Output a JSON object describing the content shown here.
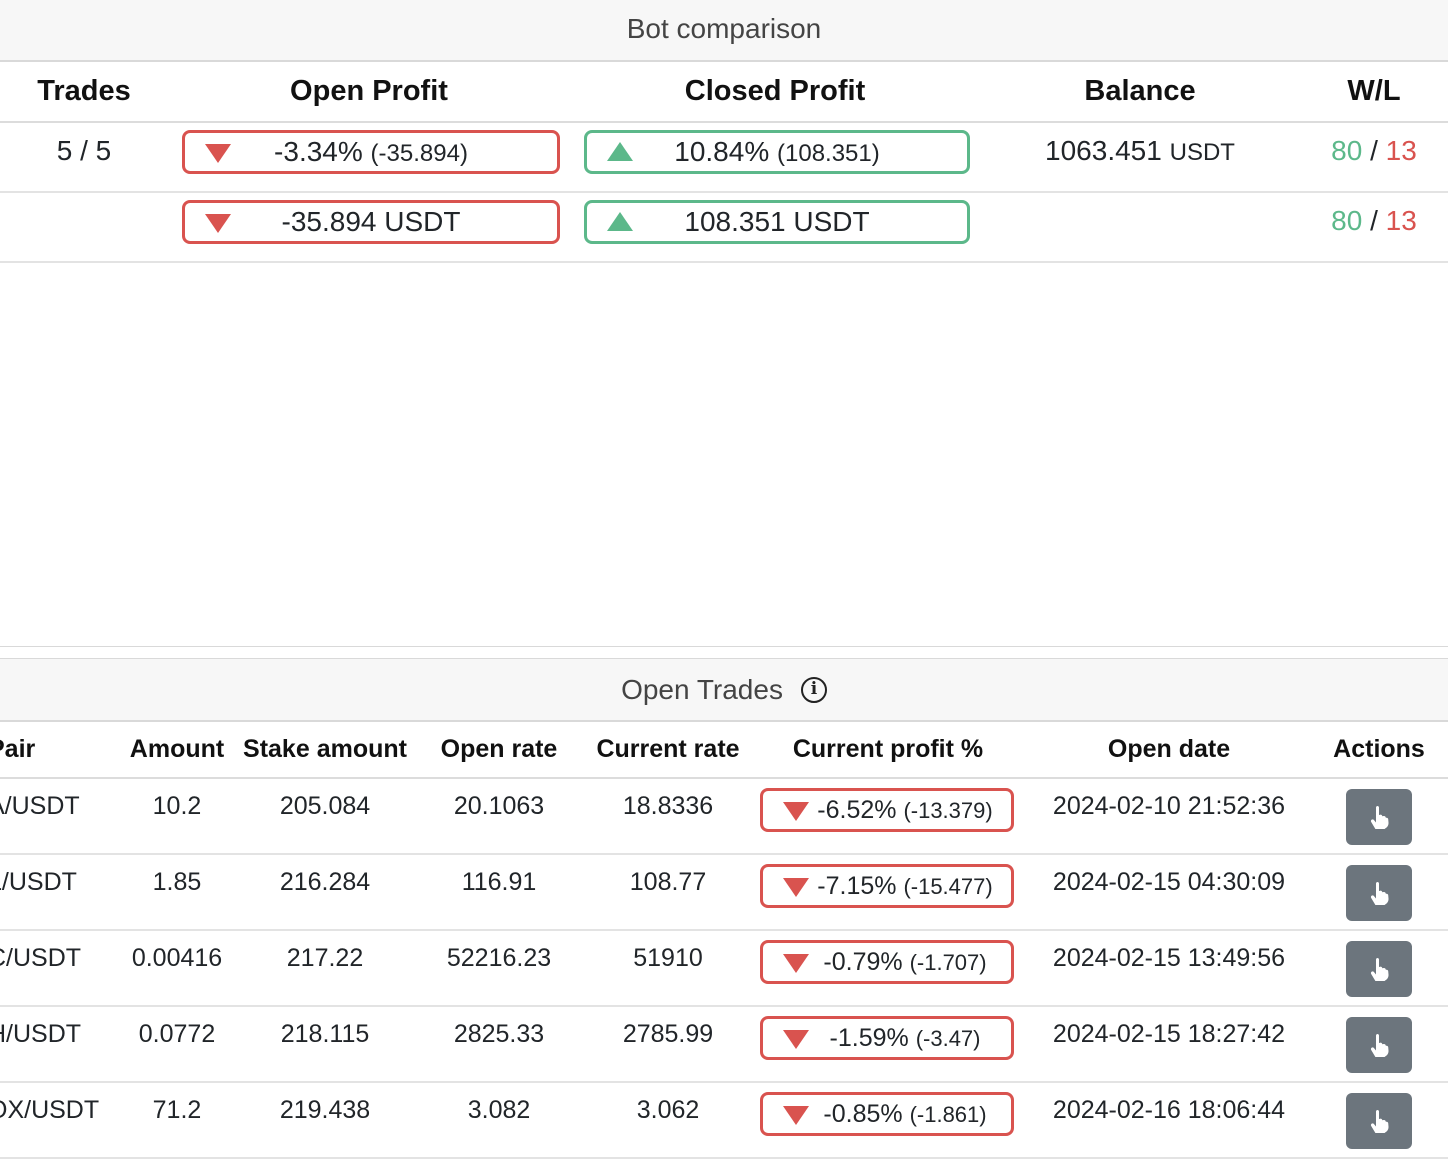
{
  "bot_comparison": {
    "title": "Bot comparison",
    "columns": {
      "trades": "Trades",
      "open_profit": "Open Profit",
      "closed_profit": "Closed Profit",
      "balance": "Balance",
      "wl": "W/L"
    },
    "rows": [
      {
        "trades": "5 / 5",
        "open_profit_main": "-3.34%",
        "open_profit_sub": "(-35.894)",
        "closed_profit_main": "10.84%",
        "closed_profit_sub": "(108.351)",
        "balance_value": "1063.451",
        "balance_currency": "USDT",
        "wins": "80",
        "sep": " / ",
        "losses": "13"
      },
      {
        "trades": "",
        "open_profit_main": "-35.894 USDT",
        "open_profit_sub": "",
        "closed_profit_main": "108.351 USDT",
        "closed_profit_sub": "",
        "balance_value": "",
        "balance_currency": "",
        "wins": "80",
        "sep": " / ",
        "losses": "13"
      }
    ],
    "colors": {
      "positive": "#5cb88a",
      "negative": "#d9534f"
    }
  },
  "open_trades": {
    "title": "Open Trades",
    "info_icon": "info-icon",
    "columns": {
      "pair": "Pair",
      "amount": "Amount",
      "stake_amount": "Stake amount",
      "open_rate": "Open rate",
      "current_rate": "Current rate",
      "current_profit": "Current profit %",
      "open_date": "Open date",
      "actions": "Actions"
    },
    "rows": [
      {
        "pair": "A/USDT",
        "amount": "10.2",
        "stake": "205.084",
        "open_rate": "20.1063",
        "current_rate": "18.8336",
        "profit_pct": "-6.52%",
        "profit_abs": "(-13.379)",
        "open_date": "2024-02-10 21:52:36"
      },
      {
        "pair": "L/USDT",
        "amount": "1.85",
        "stake": "216.284",
        "open_rate": "116.91",
        "current_rate": "108.77",
        "profit_pct": "-7.15%",
        "profit_abs": "(-15.477)",
        "open_date": "2024-02-15 04:30:09"
      },
      {
        "pair": "C/USDT",
        "amount": "0.00416",
        "stake": "217.22",
        "open_rate": "52216.23",
        "current_rate": "51910",
        "profit_pct": "-0.79%",
        "profit_abs": "(-1.707)",
        "open_date": "2024-02-15 13:49:56"
      },
      {
        "pair": "H/USDT",
        "amount": "0.0772",
        "stake": "218.115",
        "open_rate": "2825.33",
        "current_rate": "2785.99",
        "profit_pct": "-1.59%",
        "profit_abs": "(-3.47)",
        "open_date": "2024-02-15 18:27:42"
      },
      {
        "pair": "OX/USDT",
        "amount": "71.2",
        "stake": "219.438",
        "open_rate": "3.082",
        "current_rate": "3.062",
        "profit_pct": "-0.85%",
        "profit_abs": "(-1.861)",
        "open_date": "2024-02-16 18:06:44"
      }
    ],
    "action_icon": "pointer-hand-icon"
  }
}
